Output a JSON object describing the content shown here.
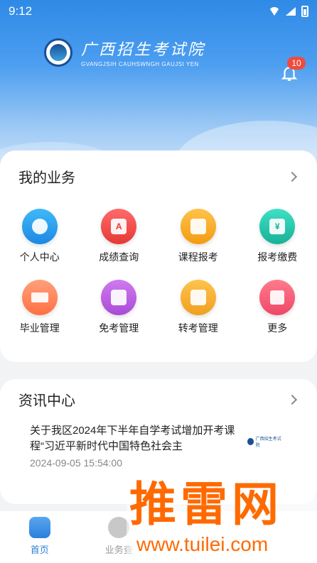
{
  "status": {
    "time": "9:12"
  },
  "header": {
    "logo_cn": "广西招生考试院",
    "logo_en": "GVANGJSIH CAUHSWNGH GAUJSI YEN",
    "notification_count": "10"
  },
  "business": {
    "title": "我的业务",
    "items": [
      {
        "label": "个人中心",
        "icon": "person-icon",
        "color": "#1e88e5"
      },
      {
        "label": "成绩查询",
        "icon": "grade-icon",
        "color": "#e53935"
      },
      {
        "label": "课程报考",
        "icon": "course-icon",
        "color": "#f39c12"
      },
      {
        "label": "报考缴费",
        "icon": "payment-icon",
        "color": "#17b197"
      },
      {
        "label": "毕业管理",
        "icon": "graduation-cap-icon",
        "color": "#ff7043"
      },
      {
        "label": "免考管理",
        "icon": "exemption-icon",
        "color": "#a94bd6"
      },
      {
        "label": "转考管理",
        "icon": "transfer-icon",
        "color": "#f0a020"
      },
      {
        "label": "更多",
        "icon": "more-grid-icon",
        "color": "#ee4866"
      }
    ]
  },
  "news": {
    "title": "资讯中心",
    "items": [
      {
        "title": "关于我区2024年下半年自学考试增加开考课程“习近平新时代中国特色社会主",
        "date": "2024-09-05 15:54:00"
      }
    ]
  },
  "tabbar": {
    "items": [
      {
        "label": "首页",
        "active": true
      },
      {
        "label": "业务查",
        "active": false
      }
    ]
  },
  "watermark": {
    "main": "推雷网",
    "url": "www.tuilei.com"
  }
}
